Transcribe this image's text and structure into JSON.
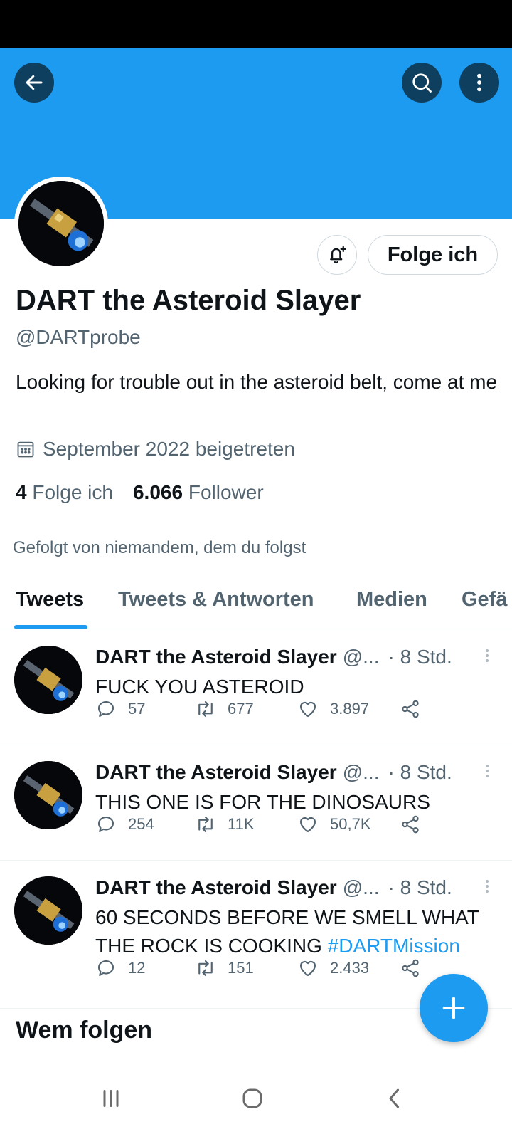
{
  "colors": {
    "brand": "#1d9bf0",
    "text": "#0f1419",
    "muted": "#536471",
    "border": "#cfd9de"
  },
  "profile": {
    "name": "DART the Asteroid Slayer",
    "handle": "@DARTprobe",
    "bio": "Looking for trouble out in the asteroid belt, come at me",
    "joined": "September 2022 beigetreten",
    "following_count": "4",
    "following_label": "Folge ich",
    "followers_count": "6.066",
    "followers_label": "Follower",
    "followed_by": "Gefolgt von niemandem, dem du folgst",
    "follow_button": "Folge ich"
  },
  "tabs": [
    {
      "label": "Tweets",
      "active": true
    },
    {
      "label": "Tweets & Antworten",
      "active": false
    },
    {
      "label": "Medien",
      "active": false
    },
    {
      "label": "Gefä",
      "active": false
    }
  ],
  "tweets": [
    {
      "name": "DART the Asteroid Slayer",
      "handle": "@...",
      "time": "· 8 Std.",
      "text": "FUCK YOU ASTEROID",
      "hashtag": "",
      "replies": "57",
      "retweets": "677",
      "likes": "3.897"
    },
    {
      "name": "DART the Asteroid Slayer",
      "handle": "@...",
      "time": "· 8 Std.",
      "text": "THIS ONE IS FOR THE DINOSAURS",
      "hashtag": "",
      "replies": "254",
      "retweets": "11K",
      "likes": "50,7K"
    },
    {
      "name": "DART the Asteroid Slayer",
      "handle": "@...",
      "time": "· 8 Std.",
      "text": "60 SECONDS BEFORE WE SMELL WHAT THE ROCK IS COOKING ",
      "hashtag": "#DARTMission",
      "replies": "12",
      "retweets": "151",
      "likes": "2.433"
    }
  ],
  "who_to_follow": "Wem folgen",
  "icons": [
    "back-arrow-icon",
    "search-icon",
    "more-vertical-icon",
    "bell-plus-icon",
    "calendar-icon",
    "reply-icon",
    "retweet-icon",
    "like-icon",
    "share-icon",
    "compose-plus-icon",
    "recent-apps-icon",
    "home-icon",
    "nav-back-icon"
  ]
}
